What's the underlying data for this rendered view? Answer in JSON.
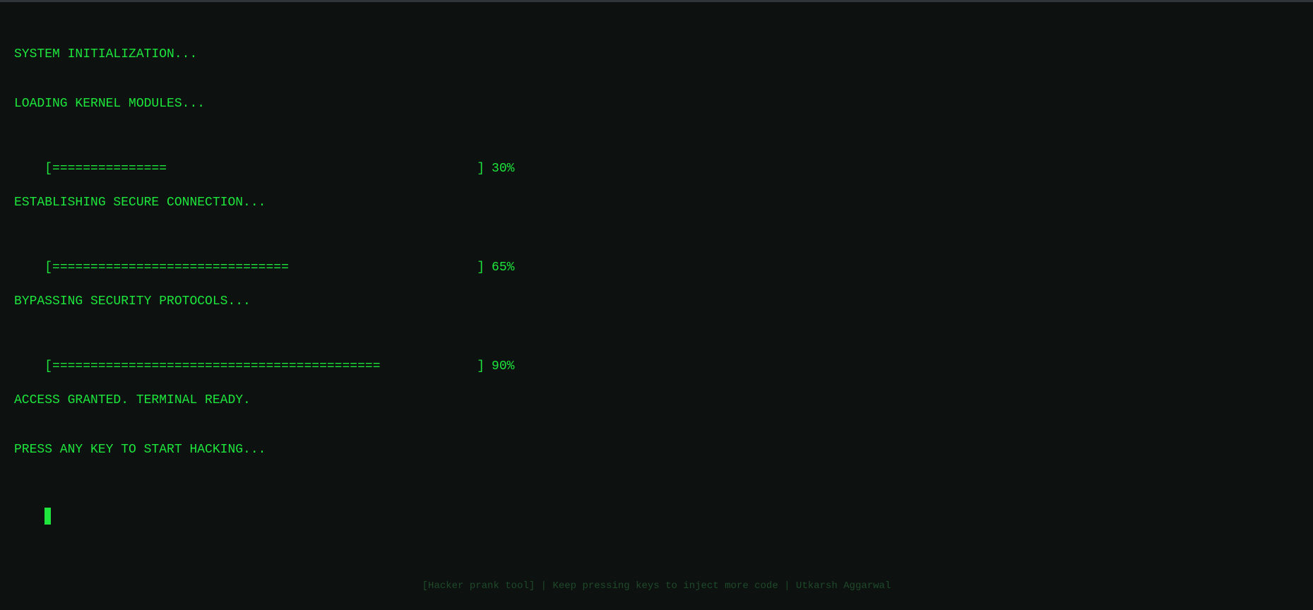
{
  "terminal": {
    "lines": [
      {
        "text": "SYSTEM INITIALIZATION..."
      },
      {
        "text": "LOADING KERNEL MODULES..."
      },
      {
        "bar": "[===============",
        "end": "]",
        "percent_label": "30%",
        "progress": 0.3
      },
      {
        "text": "ESTABLISHING SECURE CONNECTION..."
      },
      {
        "bar": "[===============================",
        "end": "]",
        "percent_label": "65%",
        "progress": 0.65
      },
      {
        "text": "BYPASSING SECURITY PROTOCOLS..."
      },
      {
        "bar": "[===========================================",
        "end": "]",
        "percent_label": "90%",
        "progress": 0.9
      },
      {
        "text": "ACCESS GRANTED. TERMINAL READY."
      },
      {
        "text": "PRESS ANY KEY TO START HACKING..."
      }
    ]
  },
  "footer": {
    "text": "[Hacker prank tool] | Keep pressing keys to inject more code | Utkarsh Aggarwal"
  },
  "colors": {
    "background": "#0d1110",
    "text": "#1ee63c",
    "footer": "#1f4a2a"
  }
}
